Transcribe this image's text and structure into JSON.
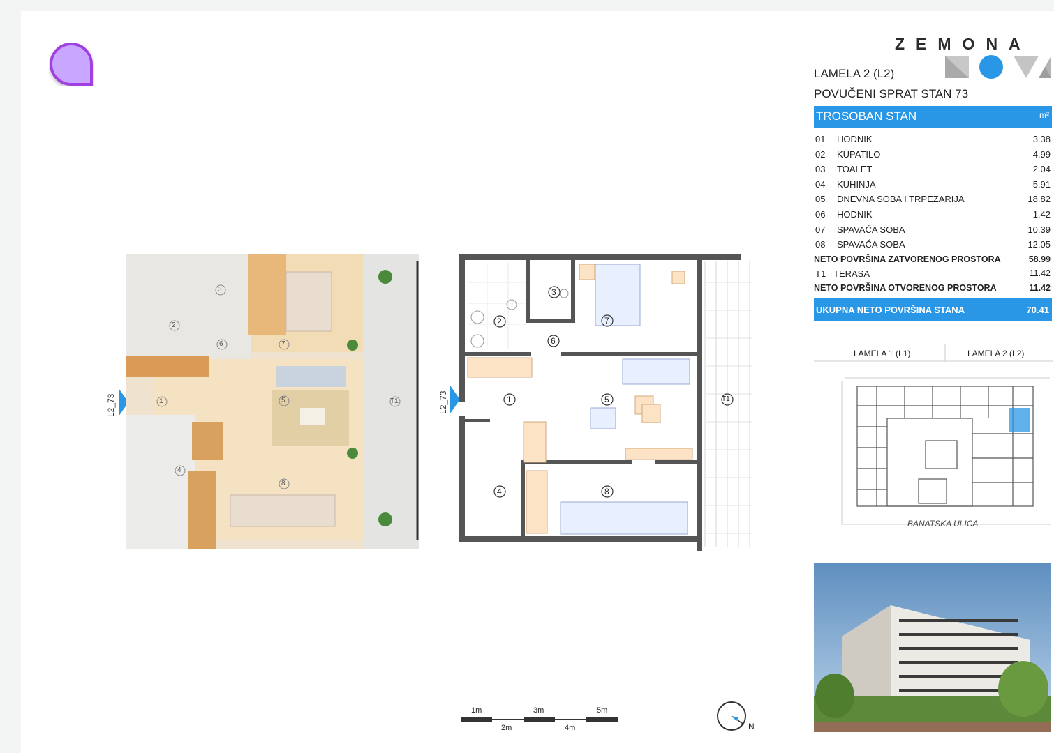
{
  "brand": {
    "line1": "ZEMONA",
    "line2": "NOVA"
  },
  "heading": {
    "lamela": "LAMELA 2 (L2)",
    "unit": "POVUČENI SPRAT STAN 73"
  },
  "table": {
    "title": "TROSOBAN STAN",
    "unit": "m²",
    "rooms": [
      {
        "no": "01",
        "name": "HODNIK",
        "area": "3.38"
      },
      {
        "no": "02",
        "name": "KUPATILO",
        "area": "4.99"
      },
      {
        "no": "03",
        "name": "TOALET",
        "area": "2.04"
      },
      {
        "no": "04",
        "name": "KUHINJA",
        "area": "5.91"
      },
      {
        "no": "05",
        "name": "DNEVNA SOBA I TRPEZARIJA",
        "area": "18.82"
      },
      {
        "no": "06",
        "name": "HODNIK",
        "area": "1.42"
      },
      {
        "no": "07",
        "name": "SPAVAĆA SOBA",
        "area": "10.39"
      },
      {
        "no": "08",
        "name": "SPAVAĆA SOBA",
        "area": "12.05"
      }
    ],
    "closed_total": {
      "label": "NETO POVRŠINA ZATVORENOG PROSTORA",
      "area": "58.99"
    },
    "terrace": {
      "no": "T1",
      "name": "TERASA",
      "area": "11.42"
    },
    "open_total": {
      "label": "NETO POVRŠINA OTVORENOG PROSTORA",
      "area": "11.42"
    },
    "grand_total": {
      "label": "UKUPNA NETO POVRŠINA STANA",
      "area": "70.41"
    }
  },
  "section_mark": "L2_73",
  "plan_labels": [
    "1",
    "2",
    "3",
    "4",
    "5",
    "6",
    "7",
    "8",
    "T1"
  ],
  "siteplan": {
    "lamela1": "LAMELA 1  (L1)",
    "lamela2": "LAMELA 2  (L2)",
    "street": "BANATSKA ULICA"
  },
  "scale": {
    "top": [
      "1m",
      "3m",
      "5m"
    ],
    "bottom": [
      "2m",
      "4m"
    ]
  },
  "compass": {
    "north": "N"
  },
  "colors": {
    "accent": "#2a97e6",
    "fab": "#c9a6ff",
    "fab_ring": "#a040e0"
  }
}
